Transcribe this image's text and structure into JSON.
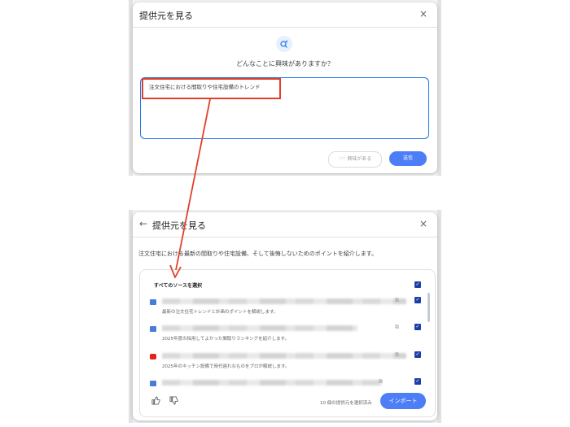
{
  "dialog1": {
    "title": "提供元を見る",
    "close_icon": "×",
    "prompt_icon": "search-sparkle-icon",
    "question": "どんなことに興味がありますか？",
    "query_text": "注文住宅における間取りや住宅設備のトレンド",
    "interest_chip_label": "♡⁺ 興味がある",
    "send_label": "送信"
  },
  "dialog2": {
    "back_icon": "←",
    "title": "提供元を見る",
    "close_icon": "×",
    "description": "注文住宅における最新の間取りや住宅設備、そして後悔しないためのポイントを紹介します。",
    "select_all_label": "すべてのソースを選択",
    "sources": [
      {
        "icon": "web-page-icon",
        "snippet": "最新の注文住宅トレンドと計画のポイントを解説します。"
      },
      {
        "icon": "web-page-icon",
        "snippet": "2025年度の採用してよかった間取りランキングを紹介します。"
      },
      {
        "icon": "youtube-icon",
        "snippet": "2025年のキッチン設備で時代遅れなものをプロが解説します。"
      },
      {
        "icon": "web-page-icon",
        "snippet": ""
      }
    ],
    "selected_count": "10 個の提供元を選択済み",
    "import_label": "インポート"
  },
  "colors": {
    "accent": "#4d7ef7",
    "highlight": "#e0402a",
    "checkbox": "#1a3fa8"
  }
}
